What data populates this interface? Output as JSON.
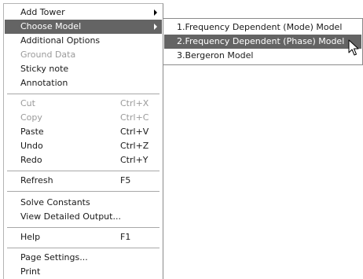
{
  "context_menu": {
    "items": [
      {
        "label": "Add Tower",
        "has_submenu": true
      },
      {
        "label": "Choose Model",
        "has_submenu": true,
        "highlighted": true
      },
      {
        "label": "Additional Options"
      },
      {
        "label": "Ground Data",
        "disabled": true
      },
      {
        "label": "Sticky note"
      },
      {
        "label": "Annotation"
      },
      {
        "label": "Cut",
        "shortcut": "Ctrl+X",
        "disabled": true
      },
      {
        "label": "Copy",
        "shortcut": "Ctrl+C",
        "disabled": true
      },
      {
        "label": "Paste",
        "shortcut": "Ctrl+V"
      },
      {
        "label": "Undo",
        "shortcut": "Ctrl+Z"
      },
      {
        "label": "Redo",
        "shortcut": "Ctrl+Y"
      },
      {
        "label": "Refresh",
        "shortcut": "F5"
      },
      {
        "label": "Solve Constants"
      },
      {
        "label": "View Detailed Output..."
      },
      {
        "label": "Help",
        "shortcut": "F1"
      },
      {
        "label": "Page Settings..."
      },
      {
        "label": "Print"
      }
    ]
  },
  "submenu": {
    "items": [
      {
        "label": "1.Frequency Dependent (Mode) Model"
      },
      {
        "label": "2.Frequency Dependent (Phase) Model",
        "highlighted": true
      },
      {
        "label": "3.Bergeron Model"
      }
    ]
  },
  "colors": {
    "highlight_bg": "#646464",
    "highlight_text": "#ffffff",
    "disabled_text": "#9a9a9a",
    "text": "#1a1a1a"
  },
  "icons": {
    "submenu_indicator": "triangle-right-icon",
    "pointer": "mouse-cursor-icon"
  }
}
